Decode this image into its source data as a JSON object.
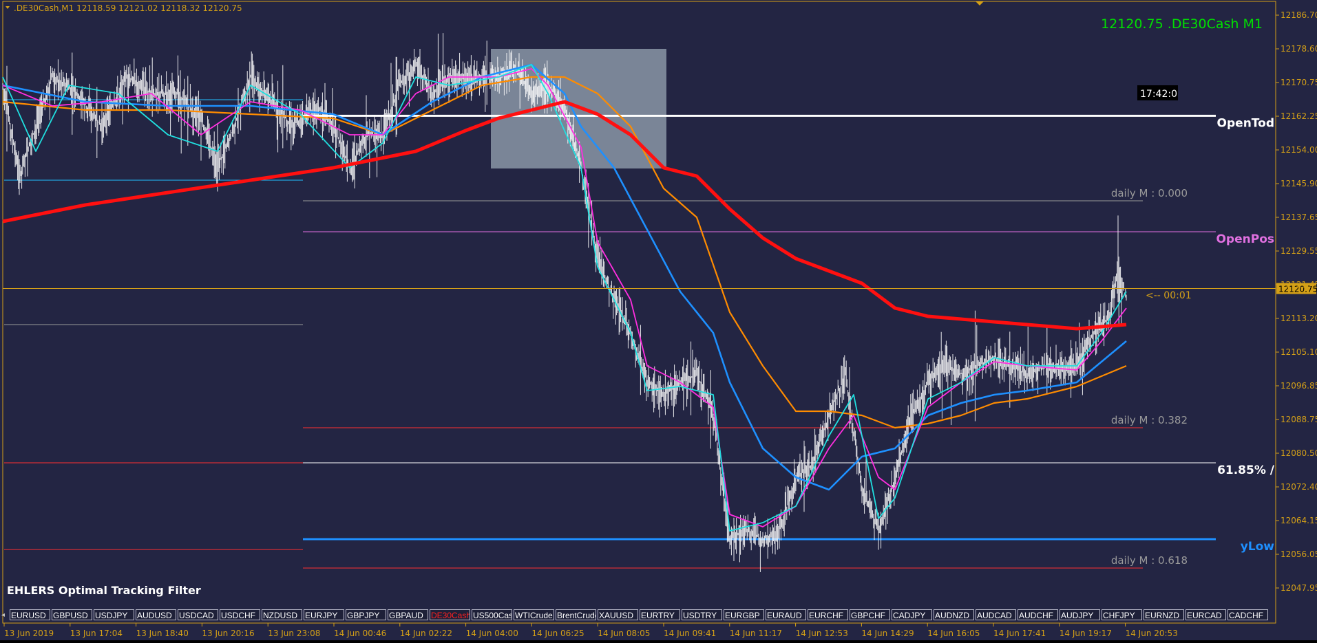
{
  "header": {
    "symbol_info": ".DE30Cash,M1  12118.59 12121.02 12118.32 12120.75",
    "big_price": "12120.75 .DE30Cash M1",
    "clock": "17:42:0",
    "indicator_name": "EHLERS Optimal Tracking Filter",
    "countdown": "<-- 00:01"
  },
  "colors": {
    "background": "#232543",
    "axis": "#d4a017",
    "price_bars": "#ffffff",
    "ma_red": "#ff1010",
    "ma_orange": "#ff8c00",
    "ma_blue": "#1e90ff",
    "ma_magenta": "#ff2ee0",
    "ma_cyan": "#20e0e0"
  },
  "levels": [
    {
      "name": "OpenTod",
      "label": "OpenTod",
      "price": 12162.6,
      "color": "#ffffff"
    },
    {
      "name": "daily-m-0",
      "label": "daily M : 0.000",
      "price": 12142.0,
      "color": "#9a9a9a"
    },
    {
      "name": "OpenPos",
      "label": "OpenPos",
      "price": 12134.5,
      "color": "#e070e0"
    },
    {
      "name": "daily-m-382",
      "label": "daily M : 0.382",
      "price": 12087.0,
      "color": "#ff3030"
    },
    {
      "name": "fib-6185",
      "label": "61.85% /",
      "price": 12078.5,
      "color": "#ffffff"
    },
    {
      "name": "yLow",
      "label": "yLow",
      "price": 12060.0,
      "color": "#1e90ff"
    },
    {
      "name": "daily-m-618",
      "label": "daily M : 0.618",
      "price": 12053.0,
      "color": "#ff3030"
    }
  ],
  "left_levels": [
    {
      "price": 12166.5,
      "color": "#20c0ff"
    },
    {
      "price": 12147.0,
      "color": "#20c0ff"
    },
    {
      "price": 12112.0,
      "color": "#9a9a9a"
    },
    {
      "price": 12078.5,
      "color": "#ff3030"
    },
    {
      "price": 12057.5,
      "color": "#ff3030"
    }
  ],
  "current_price": 12120.75,
  "current_price_label": "12120.75",
  "price_axis": {
    "min": 12045.0,
    "max": 12190.0,
    "ticks": [
      "12186.70",
      "12178.60",
      "12170.75",
      "12162.25",
      "12154.00",
      "12145.90",
      "12137.65",
      "12129.55",
      "12121.45",
      "12113.20",
      "12105.10",
      "12096.85",
      "12088.75",
      "12080.50",
      "12072.40",
      "12064.15",
      "12056.05",
      "12047.95"
    ]
  },
  "time_axis": {
    "labels": [
      "13 Jun 2019",
      "13 Jun 17:04",
      "13 Jun 18:40",
      "13 Jun 20:16",
      "13 Jun 23:08",
      "14 Jun 00:46",
      "14 Jun 02:22",
      "14 Jun 04:00",
      "14 Jun 06:25",
      "14 Jun 08:05",
      "14 Jun 09:41",
      "14 Jun 11:17",
      "14 Jun 12:53",
      "14 Jun 14:29",
      "14 Jun 16:05",
      "14 Jun 17:41",
      "14 Jun 19:17",
      "14 Jun 20:53"
    ]
  },
  "price_path": [
    [
      0,
      12170
    ],
    [
      20,
      12148
    ],
    [
      40,
      12160
    ],
    [
      60,
      12172
    ],
    [
      90,
      12168
    ],
    [
      120,
      12160
    ],
    [
      150,
      12172
    ],
    [
      180,
      12168
    ],
    [
      210,
      12168
    ],
    [
      240,
      12162
    ],
    [
      260,
      12150
    ],
    [
      280,
      12160
    ],
    [
      300,
      12172
    ],
    [
      330,
      12165
    ],
    [
      350,
      12160
    ],
    [
      380,
      12165
    ],
    [
      400,
      12160
    ],
    [
      420,
      12150
    ],
    [
      440,
      12158
    ],
    [
      460,
      12158
    ],
    [
      480,
      12170
    ],
    [
      500,
      12175
    ],
    [
      520,
      12168
    ],
    [
      540,
      12172
    ],
    [
      560,
      12172
    ],
    [
      580,
      12172
    ],
    [
      600,
      12172
    ],
    [
      620,
      12174
    ],
    [
      640,
      12168
    ],
    [
      660,
      12170
    ],
    [
      680,
      12165
    ],
    [
      700,
      12150
    ],
    [
      720,
      12128
    ],
    [
      740,
      12118
    ],
    [
      760,
      12110
    ],
    [
      780,
      12098
    ],
    [
      800,
      12095
    ],
    [
      820,
      12098
    ],
    [
      840,
      12100
    ],
    [
      860,
      12090
    ],
    [
      880,
      12060
    ],
    [
      900,
      12062
    ],
    [
      920,
      12060
    ],
    [
      940,
      12062
    ],
    [
      960,
      12075
    ],
    [
      980,
      12078
    ],
    [
      1000,
      12090
    ],
    [
      1020,
      12100
    ],
    [
      1040,
      12072
    ],
    [
      1060,
      12062
    ],
    [
      1080,
      12075
    ],
    [
      1100,
      12090
    ],
    [
      1120,
      12098
    ],
    [
      1140,
      12102
    ],
    [
      1160,
      12100
    ],
    [
      1180,
      12102
    ],
    [
      1200,
      12104
    ],
    [
      1220,
      12102
    ],
    [
      1240,
      12100
    ],
    [
      1260,
      12102
    ],
    [
      1280,
      12101
    ],
    [
      1300,
      12102
    ],
    [
      1320,
      12110
    ],
    [
      1340,
      12114
    ],
    [
      1350,
      12126
    ],
    [
      1360,
      12118
    ]
  ],
  "ma_red_path": [
    [
      0,
      12137
    ],
    [
      100,
      12141
    ],
    [
      200,
      12144
    ],
    [
      300,
      12147
    ],
    [
      400,
      12150
    ],
    [
      500,
      12154
    ],
    [
      560,
      12159
    ],
    [
      600,
      12162
    ],
    [
      640,
      12164
    ],
    [
      680,
      12166
    ],
    [
      720,
      12163
    ],
    [
      760,
      12158
    ],
    [
      800,
      12150
    ],
    [
      840,
      12148
    ],
    [
      880,
      12140
    ],
    [
      920,
      12133
    ],
    [
      960,
      12128
    ],
    [
      1000,
      12125
    ],
    [
      1040,
      12122
    ],
    [
      1080,
      12116
    ],
    [
      1120,
      12114
    ],
    [
      1180,
      12113
    ],
    [
      1240,
      12112
    ],
    [
      1300,
      12111
    ],
    [
      1360,
      12112
    ]
  ],
  "ma_orange_path": [
    [
      0,
      12166
    ],
    [
      100,
      12164
    ],
    [
      200,
      12164
    ],
    [
      300,
      12163
    ],
    [
      400,
      12162
    ],
    [
      460,
      12158
    ],
    [
      520,
      12164
    ],
    [
      580,
      12170
    ],
    [
      640,
      12172
    ],
    [
      680,
      12172
    ],
    [
      720,
      12168
    ],
    [
      760,
      12160
    ],
    [
      800,
      12145
    ],
    [
      840,
      12138
    ],
    [
      880,
      12115
    ],
    [
      920,
      12102
    ],
    [
      960,
      12091
    ],
    [
      1000,
      12091
    ],
    [
      1040,
      12090
    ],
    [
      1080,
      12087
    ],
    [
      1120,
      12088
    ],
    [
      1160,
      12090
    ],
    [
      1200,
      12093
    ],
    [
      1240,
      12094
    ],
    [
      1300,
      12097
    ],
    [
      1360,
      12102
    ]
  ],
  "ma_blue_path": [
    [
      0,
      12170
    ],
    [
      100,
      12166
    ],
    [
      200,
      12165
    ],
    [
      300,
      12165
    ],
    [
      400,
      12163
    ],
    [
      460,
      12158
    ],
    [
      520,
      12166
    ],
    [
      580,
      12172
    ],
    [
      640,
      12175
    ],
    [
      680,
      12168
    ],
    [
      700,
      12160
    ],
    [
      740,
      12150
    ],
    [
      780,
      12135
    ],
    [
      820,
      12120
    ],
    [
      860,
      12110
    ],
    [
      880,
      12098
    ],
    [
      920,
      12082
    ],
    [
      960,
      12075
    ],
    [
      1000,
      12072
    ],
    [
      1040,
      12080
    ],
    [
      1080,
      12082
    ],
    [
      1120,
      12090
    ],
    [
      1160,
      12093
    ],
    [
      1200,
      12095
    ],
    [
      1240,
      12096
    ],
    [
      1300,
      12098
    ],
    [
      1360,
      12108
    ]
  ],
  "ma_magenta_path": [
    [
      0,
      12170
    ],
    [
      60,
      12165
    ],
    [
      120,
      12166
    ],
    [
      180,
      12168
    ],
    [
      240,
      12158
    ],
    [
      300,
      12166
    ],
    [
      360,
      12164
    ],
    [
      420,
      12158
    ],
    [
      460,
      12158
    ],
    [
      500,
      12168
    ],
    [
      540,
      12172
    ],
    [
      600,
      12172
    ],
    [
      640,
      12174
    ],
    [
      660,
      12170
    ],
    [
      700,
      12155
    ],
    [
      720,
      12132
    ],
    [
      760,
      12118
    ],
    [
      780,
      12102
    ],
    [
      820,
      12098
    ],
    [
      860,
      12092
    ],
    [
      880,
      12066
    ],
    [
      920,
      12063
    ],
    [
      960,
      12068
    ],
    [
      1000,
      12082
    ],
    [
      1030,
      12090
    ],
    [
      1060,
      12075
    ],
    [
      1080,
      12072
    ],
    [
      1120,
      12092
    ],
    [
      1160,
      12098
    ],
    [
      1200,
      12103
    ],
    [
      1240,
      12102
    ],
    [
      1300,
      12101
    ],
    [
      1330,
      12108
    ],
    [
      1360,
      12116
    ]
  ],
  "ma_cyan_path": [
    [
      0,
      12172
    ],
    [
      40,
      12154
    ],
    [
      80,
      12170
    ],
    [
      140,
      12168
    ],
    [
      200,
      12158
    ],
    [
      260,
      12154
    ],
    [
      300,
      12170
    ],
    [
      360,
      12163
    ],
    [
      420,
      12150
    ],
    [
      460,
      12156
    ],
    [
      500,
      12172
    ],
    [
      540,
      12170
    ],
    [
      600,
      12172
    ],
    [
      640,
      12175
    ],
    [
      660,
      12168
    ],
    [
      700,
      12150
    ],
    [
      720,
      12126
    ],
    [
      760,
      12110
    ],
    [
      780,
      12096
    ],
    [
      820,
      12097
    ],
    [
      860,
      12095
    ],
    [
      880,
      12062
    ],
    [
      920,
      12064
    ],
    [
      960,
      12068
    ],
    [
      1000,
      12085
    ],
    [
      1030,
      12095
    ],
    [
      1060,
      12065
    ],
    [
      1080,
      12070
    ],
    [
      1120,
      12094
    ],
    [
      1160,
      12098
    ],
    [
      1200,
      12104
    ],
    [
      1240,
      12102
    ],
    [
      1300,
      12102
    ],
    [
      1330,
      12110
    ],
    [
      1360,
      12120
    ]
  ],
  "symbols": [
    "EURUSD",
    "GBPUSD",
    "USDJPY",
    "AUDUSD",
    "USDCAD",
    "USDCHF",
    "NZDUSD",
    "EURJPY",
    "GBPJPY",
    "GBPAUD",
    "DE30Cash",
    "US500Cash",
    "WTICrude",
    "BrentCrude",
    "XAUUSD",
    "EURTRY",
    "USDTRY",
    "EURGBP",
    "EURAUD",
    "EURCHF",
    "GBPCHF",
    "CADJPY",
    "AUDNZD",
    "AUDCAD",
    "AUDCHF",
    "AUDJPY",
    "CHFJPY",
    "EURNZD",
    "EURCAD",
    "CADCHF"
  ],
  "active_symbol": "DE30Cash"
}
